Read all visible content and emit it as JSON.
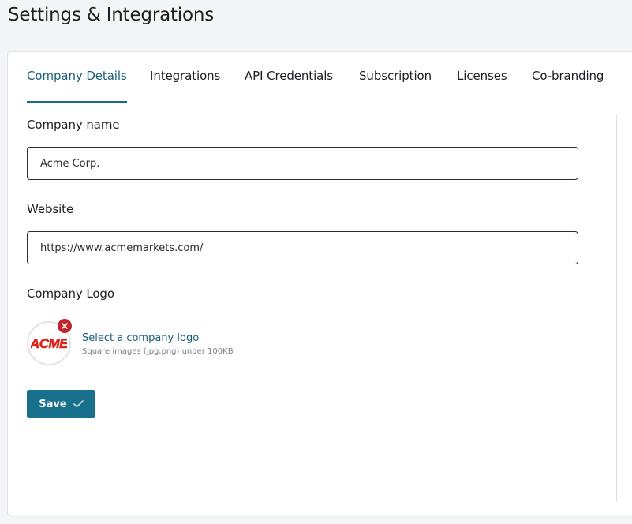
{
  "page": {
    "title": "Settings & Integrations"
  },
  "tabs": [
    {
      "label": "Company Details",
      "active": true
    },
    {
      "label": "Integrations",
      "active": false
    },
    {
      "label": "API Credentials",
      "active": false
    },
    {
      "label": "Subscription",
      "active": false
    },
    {
      "label": "Licenses",
      "active": false
    },
    {
      "label": "Co-branding",
      "active": false
    }
  ],
  "form": {
    "company_name": {
      "label": "Company name",
      "value": "Acme Corp."
    },
    "website": {
      "label": "Website",
      "value": "https://www.acmemarkets.com/"
    },
    "logo": {
      "label": "Company Logo",
      "image_text": "ACME",
      "select_link": "Select a company logo",
      "hint": "Square images (jpg,png) under 100KB",
      "remove_icon": "close-icon"
    },
    "save_label": "Save",
    "save_icon": "checkmark-icon"
  },
  "colors": {
    "accent": "#17708c",
    "accent_text": "#1a5e78",
    "danger": "#c0262d",
    "logo_red": "#e2231a"
  }
}
